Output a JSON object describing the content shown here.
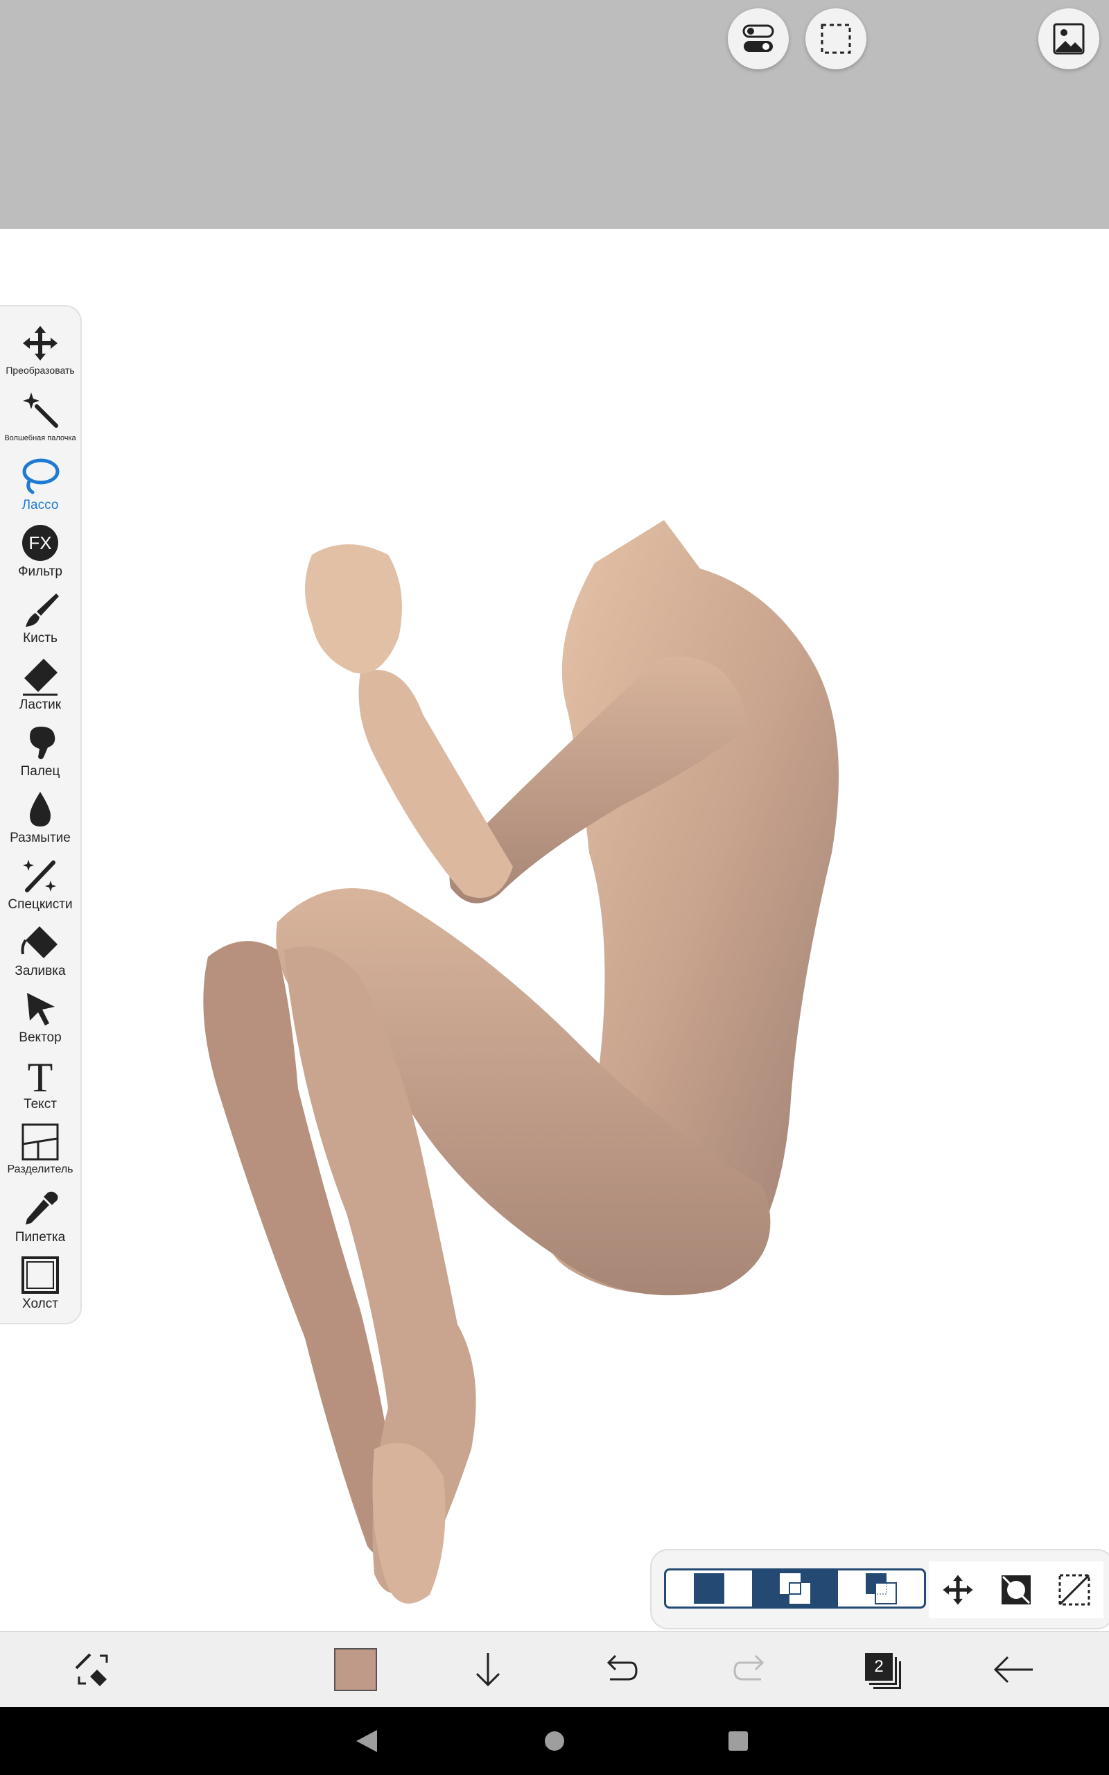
{
  "top_bar": {
    "buttons": [
      {
        "icon": "toggle-switches-icon"
      },
      {
        "icon": "selection-rectangle-icon"
      },
      {
        "icon": "image-reference-icon"
      }
    ]
  },
  "tools": [
    {
      "label": "Преобразовать",
      "icon": "move-arrows-icon",
      "active": false
    },
    {
      "label": "Волшебная палочка",
      "icon": "magic-wand-icon",
      "active": false
    },
    {
      "label": "Лассо",
      "icon": "lasso-icon",
      "active": true
    },
    {
      "label": "Фильтр",
      "icon": "fx-filter-icon",
      "active": false
    },
    {
      "label": "Кисть",
      "icon": "brush-icon",
      "active": false
    },
    {
      "label": "Ластик",
      "icon": "eraser-icon",
      "active": false
    },
    {
      "label": "Палец",
      "icon": "smudge-finger-icon",
      "active": false
    },
    {
      "label": "Размытие",
      "icon": "blur-drop-icon",
      "active": false
    },
    {
      "label": "Спецкисти",
      "icon": "special-brush-icon",
      "active": false
    },
    {
      "label": "Заливка",
      "icon": "fill-bucket-icon",
      "active": false
    },
    {
      "label": "Вектор",
      "icon": "vector-cursor-icon",
      "active": false
    },
    {
      "label": "Текст",
      "icon": "text-t-icon",
      "active": false
    },
    {
      "label": "Разделитель",
      "icon": "frame-divider-icon",
      "active": false
    },
    {
      "label": "Пипетка",
      "icon": "eyedropper-icon",
      "active": false
    },
    {
      "label": "Холст",
      "icon": "canvas-frame-icon",
      "active": false
    }
  ],
  "selection_panel": {
    "modes": [
      {
        "icon": "selection-new-icon",
        "selected": false
      },
      {
        "icon": "selection-add-icon",
        "selected": true
      },
      {
        "icon": "selection-subtract-icon",
        "selected": false
      }
    ],
    "actions": [
      {
        "icon": "move-selection-icon"
      },
      {
        "icon": "invert-selection-icon"
      },
      {
        "icon": "clear-selection-icon"
      }
    ]
  },
  "bottom_bar": {
    "current_color": "#c09a88",
    "layer_count": "2"
  },
  "colors": {
    "accent_blue": "#1f7ad1",
    "panel_navy": "#244a73",
    "top_gray": "#bdbdbd"
  }
}
